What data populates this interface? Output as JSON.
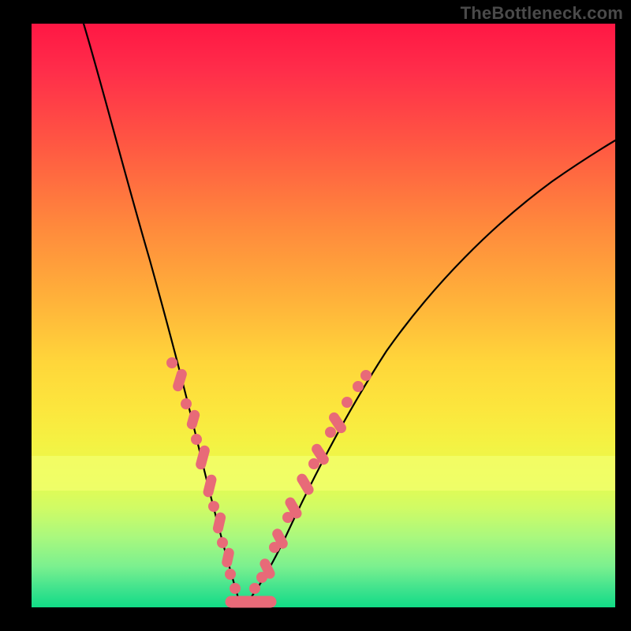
{
  "watermark": "TheBottleneck.com",
  "colors": {
    "frame": "#000000",
    "curve": "#000000",
    "marker": "#e86a78",
    "gradient_top": "#ff1744",
    "gradient_bottom": "#11dc86"
  },
  "chart_data": {
    "type": "line",
    "title": "",
    "xlabel": "",
    "ylabel": "",
    "xlim": [
      0,
      100
    ],
    "ylim": [
      0,
      100
    ],
    "legend": false,
    "axes_visible": false,
    "series": [
      {
        "name": "left-curve",
        "x": [
          9,
          12,
          15,
          18,
          20,
          22,
          24,
          26,
          28,
          29,
          30,
          31,
          32,
          33,
          34,
          35,
          36
        ],
        "y": [
          100,
          90,
          78,
          66,
          58,
          50,
          42,
          35,
          28,
          24,
          20,
          17,
          13,
          10,
          7,
          4,
          1
        ]
      },
      {
        "name": "right-curve",
        "x": [
          36,
          38,
          40,
          43,
          47,
          52,
          58,
          65,
          73,
          82,
          92,
          100
        ],
        "y": [
          1,
          4,
          8,
          14,
          22,
          32,
          42,
          52,
          61,
          69,
          76,
          81
        ]
      }
    ],
    "markers": [
      {
        "x": 24.0,
        "y": 42.0
      },
      {
        "x": 25.5,
        "y": 38.0
      },
      {
        "x": 26.5,
        "y": 34.5
      },
      {
        "x": 27.5,
        "y": 30.0
      },
      {
        "x": 28.0,
        "y": 27.5
      },
      {
        "x": 28.8,
        "y": 24.5
      },
      {
        "x": 29.5,
        "y": 21.5
      },
      {
        "x": 30.0,
        "y": 19.0
      },
      {
        "x": 30.5,
        "y": 17.0
      },
      {
        "x": 31.0,
        "y": 15.0
      },
      {
        "x": 31.5,
        "y": 13.0
      },
      {
        "x": 32.0,
        "y": 11.0
      },
      {
        "x": 32.7,
        "y": 8.5
      },
      {
        "x": 33.2,
        "y": 6.5
      },
      {
        "x": 34.0,
        "y": 4.0
      },
      {
        "x": 35.0,
        "y": 2.0
      },
      {
        "x": 36.0,
        "y": 1.0
      },
      {
        "x": 37.0,
        "y": 1.5
      },
      {
        "x": 38.0,
        "y": 3.0
      },
      {
        "x": 38.8,
        "y": 4.5
      },
      {
        "x": 39.5,
        "y": 6.0
      },
      {
        "x": 40.5,
        "y": 8.0
      },
      {
        "x": 41.5,
        "y": 10.0
      },
      {
        "x": 42.2,
        "y": 12.0
      },
      {
        "x": 43.0,
        "y": 14.0
      },
      {
        "x": 43.8,
        "y": 16.0
      },
      {
        "x": 44.8,
        "y": 18.5
      },
      {
        "x": 45.8,
        "y": 21.0
      },
      {
        "x": 47.0,
        "y": 23.5
      },
      {
        "x": 48.5,
        "y": 26.5
      },
      {
        "x": 49.7,
        "y": 29.0
      },
      {
        "x": 51.2,
        "y": 32.0
      },
      {
        "x": 52.5,
        "y": 34.5
      },
      {
        "x": 54.0,
        "y": 37.0
      },
      {
        "x": 55.5,
        "y": 39.5
      },
      {
        "x": 57.0,
        "y": 41.5
      }
    ],
    "bottom_marker_band": {
      "x_from": 33.0,
      "x_to": 40.0,
      "y": 1.0
    },
    "highlight_band_y": [
      20,
      26
    ]
  }
}
